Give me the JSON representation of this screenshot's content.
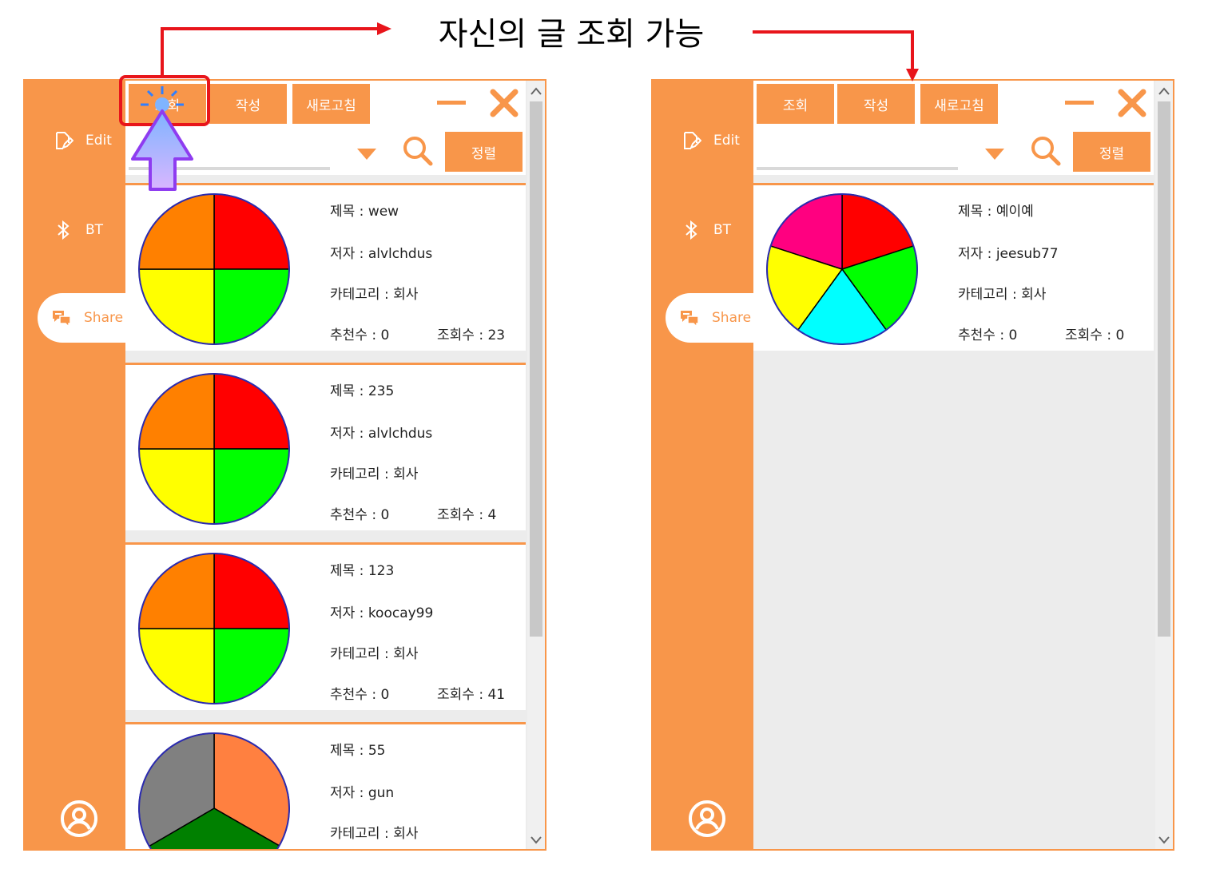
{
  "annotation": {
    "caption": "자신의 글 조회 가능"
  },
  "colors": {
    "accent": "#f8964a",
    "annotation_red": "#e8151b",
    "pointer_arrow": "#8e3cf0"
  },
  "left_window": {
    "sidebar": {
      "items": [
        {
          "label": "Edit",
          "icon": "edit-icon"
        },
        {
          "label": "BT",
          "icon": "bluetooth-icon"
        },
        {
          "label": "Share",
          "icon": "chat-icon",
          "selected": true
        }
      ],
      "profile_icon": "user-profile-icon"
    },
    "toolbar": {
      "view_label": "조회",
      "write_label": "작성",
      "refresh_label": "새로고침"
    },
    "search": {
      "value": "",
      "sort_label": "정렬"
    },
    "posts": [
      {
        "title": "제목 : wew",
        "author": "저자 : alvlchdus",
        "category": "카테고리 : 회사",
        "likes": "추천수 : 0",
        "views": "조회수 : 23",
        "pie": [
          {
            "color": "#ff0000",
            "value": 25
          },
          {
            "color": "#00ff00",
            "value": 25
          },
          {
            "color": "#ffff00",
            "value": 25
          },
          {
            "color": "#ff8000",
            "value": 25
          }
        ]
      },
      {
        "title": "제목 : 235",
        "author": "저자 : alvlchdus",
        "category": "카테고리 : 회사",
        "likes": "추천수 : 0",
        "views": "조회수 : 4",
        "pie": [
          {
            "color": "#ff0000",
            "value": 25
          },
          {
            "color": "#00ff00",
            "value": 25
          },
          {
            "color": "#ffff00",
            "value": 25
          },
          {
            "color": "#ff8000",
            "value": 25
          }
        ]
      },
      {
        "title": "제목 : 123",
        "author": "저자 : koocay99",
        "category": "카테고리 : 회사",
        "likes": "추천수 : 0",
        "views": "조회수 : 41",
        "pie": [
          {
            "color": "#ff0000",
            "value": 25
          },
          {
            "color": "#00ff00",
            "value": 25
          },
          {
            "color": "#ffff00",
            "value": 25
          },
          {
            "color": "#ff8000",
            "value": 25
          }
        ]
      },
      {
        "title": "제목 : 55",
        "author": "저자 : gun",
        "category": "카테고리 : 회사",
        "likes": "",
        "views": "",
        "pie": [
          {
            "color": "#ff8040",
            "value": 33.3
          },
          {
            "color": "#008000",
            "value": 33.3
          },
          {
            "color": "#808080",
            "value": 33.4
          }
        ]
      }
    ]
  },
  "right_window": {
    "sidebar": {
      "items": [
        {
          "label": "Edit",
          "icon": "edit-icon"
        },
        {
          "label": "BT",
          "icon": "bluetooth-icon"
        },
        {
          "label": "Share",
          "icon": "chat-icon",
          "selected": true
        }
      ],
      "profile_icon": "user-profile-icon"
    },
    "toolbar": {
      "view_label": "조회",
      "write_label": "작성",
      "refresh_label": "새로고침"
    },
    "search": {
      "value": "",
      "sort_label": "정렬"
    },
    "posts": [
      {
        "title": "제목 : 예이예",
        "author": "저자 : jeesub77",
        "category": "카테고리 : 회사",
        "likes": "추천수 : 0",
        "views": "조회수 : 0",
        "pie": [
          {
            "color": "#ff0000",
            "value": 20
          },
          {
            "color": "#00ff00",
            "value": 20
          },
          {
            "color": "#00ffff",
            "value": 20
          },
          {
            "color": "#ffff00",
            "value": 20
          },
          {
            "color": "#ff0080",
            "value": 20
          }
        ]
      }
    ]
  }
}
